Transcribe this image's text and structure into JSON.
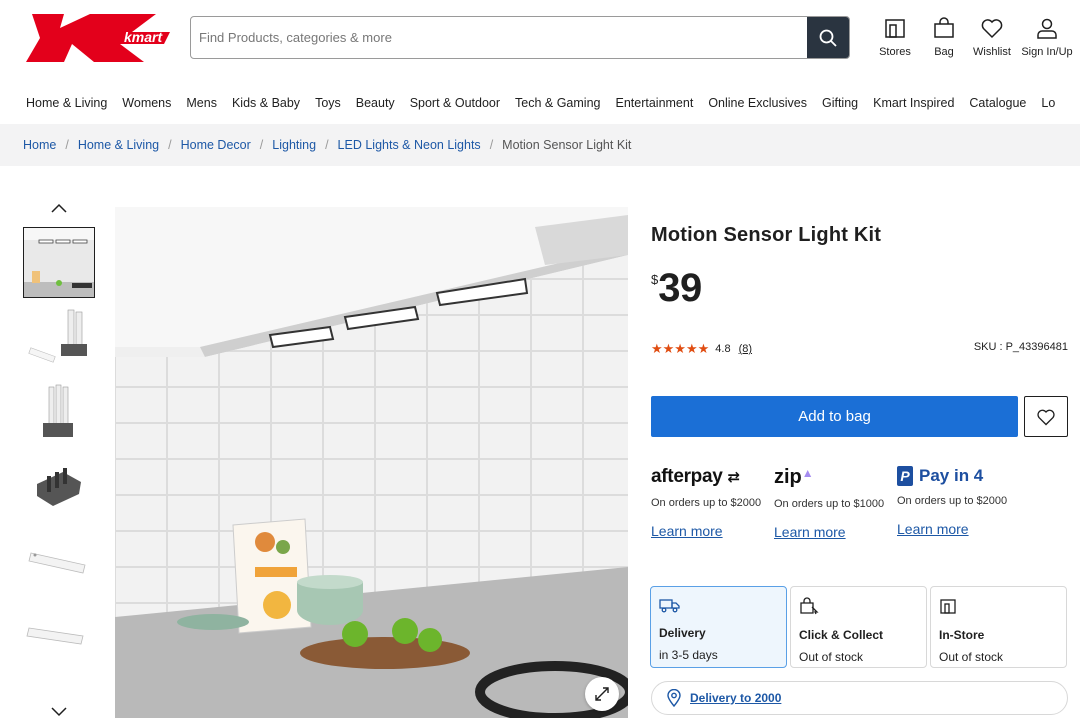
{
  "colors": {
    "brand_red": "#e3001b",
    "primary_blue": "#1b6fd6",
    "link_blue": "#1d58a6",
    "star_orange": "#e04d12"
  },
  "header": {
    "logo_text": "kmart",
    "search_placeholder": "Find Products, categories & more",
    "icons": [
      {
        "icon": "store-icon",
        "label": "Stores"
      },
      {
        "icon": "bag-icon",
        "label": "Bag"
      },
      {
        "icon": "heart-icon",
        "label": "Wishlist"
      },
      {
        "icon": "user-icon",
        "label": "Sign In/Up"
      }
    ]
  },
  "nav": [
    "Home & Living",
    "Womens",
    "Mens",
    "Kids & Baby",
    "Toys",
    "Beauty",
    "Sport & Outdoor",
    "Tech & Gaming",
    "Entertainment",
    "Online Exclusives",
    "Gifting",
    "Kmart Inspired",
    "Catalogue",
    "Lo"
  ],
  "breadcrumb": {
    "links": [
      "Home",
      "Home & Living",
      "Home Decor",
      "Lighting",
      "LED Lights & Neon Lights"
    ],
    "current": "Motion Sensor Light Kit"
  },
  "product": {
    "title": "Motion Sensor Light Kit",
    "currency": "$",
    "price": "39",
    "rating": 4.8,
    "rating_text": "4.8",
    "reviews": "(8)",
    "sku": "SKU : P_43396481",
    "add_to_bag": "Add to bag"
  },
  "payments": [
    {
      "brand": "afterpay",
      "note": "On orders up to $2000",
      "learn": "Learn more"
    },
    {
      "brand": "zip",
      "note": "On orders up to $1000",
      "learn": "Learn more"
    },
    {
      "brand": "Pay in 4",
      "note": "On orders up to $2000",
      "learn": "Learn more"
    }
  ],
  "fulfilment": [
    {
      "icon": "truck-icon",
      "title": "Delivery",
      "status": "in 3-5 days"
    },
    {
      "icon": "click-collect-icon",
      "title": "Click & Collect",
      "status": "Out of stock"
    },
    {
      "icon": "store-icon",
      "title": "In-Store",
      "status": "Out of stock"
    }
  ],
  "delivery_postcode": "Delivery to 2000"
}
